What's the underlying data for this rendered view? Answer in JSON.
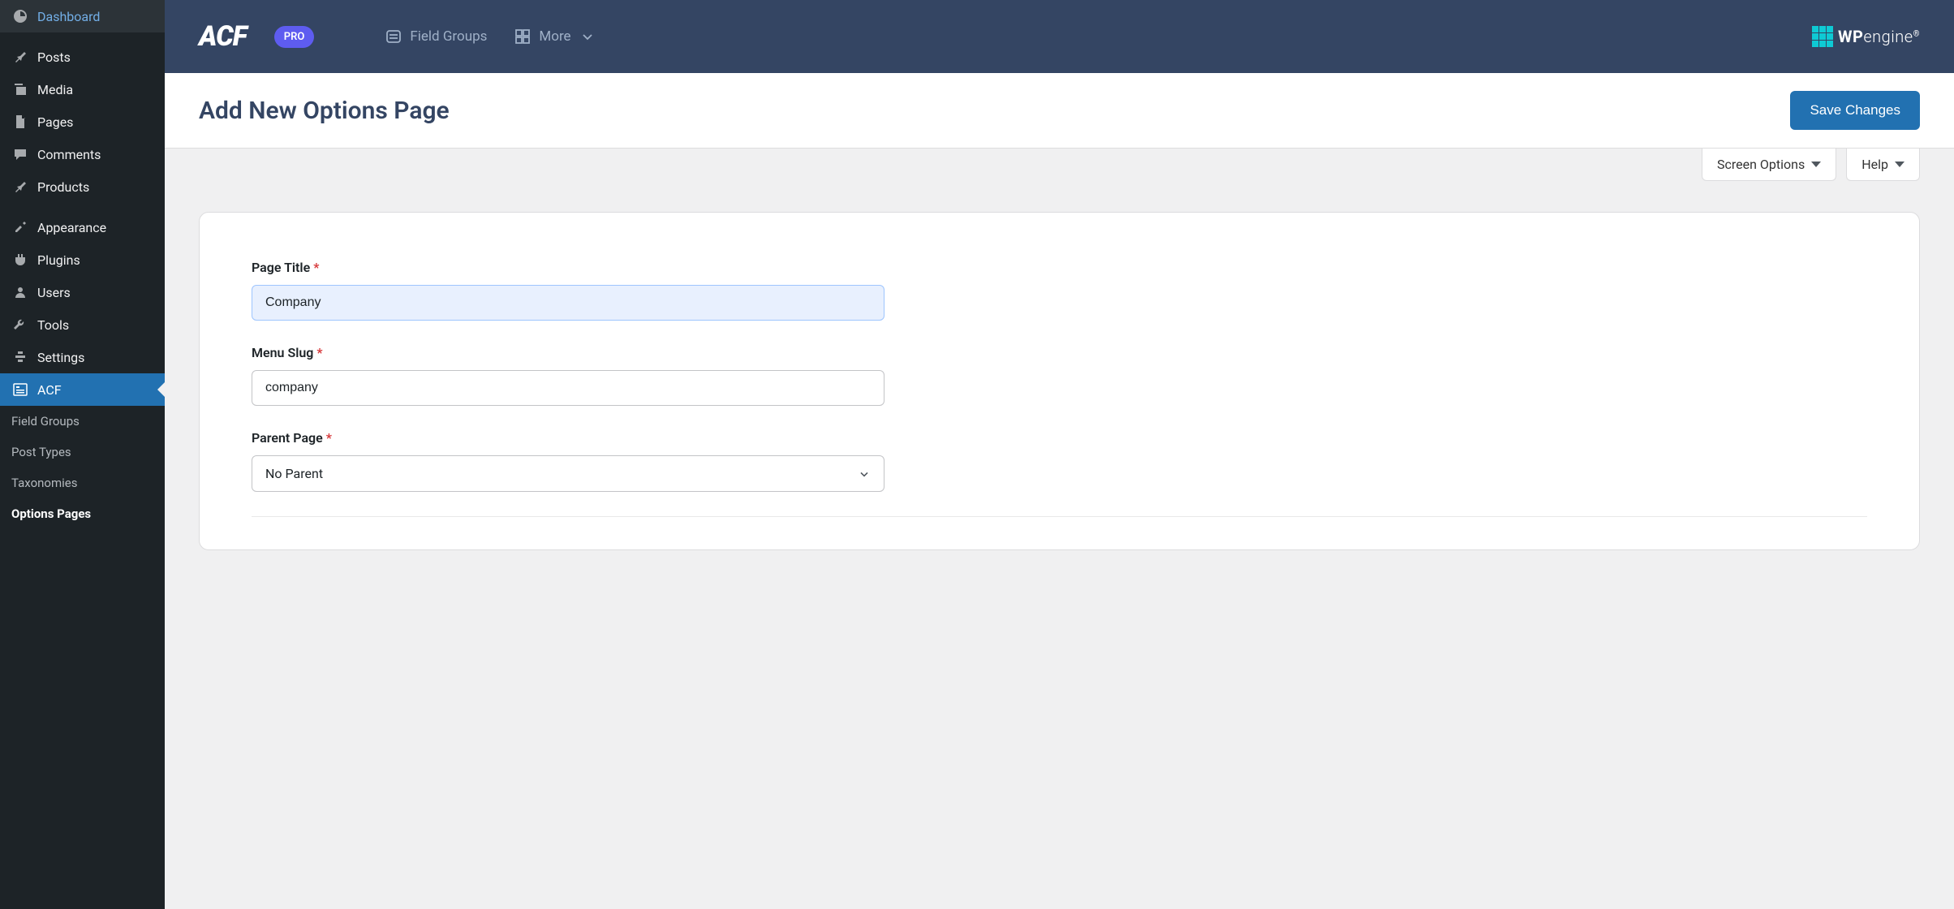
{
  "sidebar": {
    "items": [
      {
        "label": "Dashboard",
        "icon": "dashboard"
      },
      {
        "label": "Posts",
        "icon": "pin"
      },
      {
        "label": "Media",
        "icon": "media"
      },
      {
        "label": "Pages",
        "icon": "pages"
      },
      {
        "label": "Comments",
        "icon": "comment"
      },
      {
        "label": "Products",
        "icon": "pin"
      },
      {
        "label": "Appearance",
        "icon": "appearance"
      },
      {
        "label": "Plugins",
        "icon": "plugins"
      },
      {
        "label": "Users",
        "icon": "users"
      },
      {
        "label": "Tools",
        "icon": "tools"
      },
      {
        "label": "Settings",
        "icon": "settings"
      },
      {
        "label": "ACF",
        "icon": "acf"
      }
    ],
    "subitems": [
      {
        "label": "Field Groups",
        "current": false
      },
      {
        "label": "Post Types",
        "current": false
      },
      {
        "label": "Taxonomies",
        "current": false
      },
      {
        "label": "Options Pages",
        "current": true
      }
    ]
  },
  "topbar": {
    "logo_text": "ACF",
    "pro_badge": "PRO",
    "links": [
      {
        "label": "Field Groups"
      },
      {
        "label": "More"
      }
    ],
    "wpengine_wp": "WP",
    "wpengine_engine": "engine"
  },
  "page": {
    "title": "Add New Options Page",
    "save_label": "Save Changes",
    "screen_options_label": "Screen Options",
    "help_label": "Help"
  },
  "form": {
    "fields": [
      {
        "label": "Page Title",
        "value": "Company",
        "focused": true
      },
      {
        "label": "Menu Slug",
        "value": "company",
        "focused": false
      }
    ],
    "parent": {
      "label": "Parent Page",
      "value": "No Parent"
    }
  }
}
